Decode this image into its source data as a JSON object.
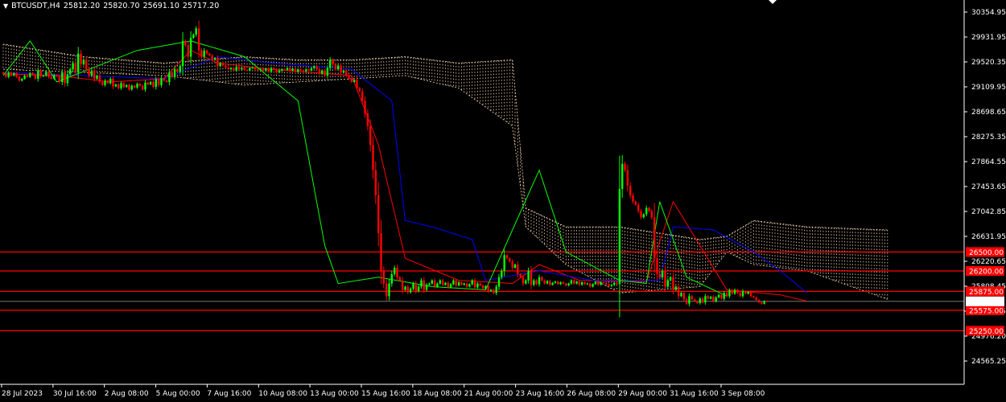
{
  "header": {
    "symbol": "BTCUSDT,H4",
    "open": "25812.20",
    "high": "25820.70",
    "low": "25691.10",
    "close": "25717.20"
  },
  "colors": {
    "background": "#000000",
    "bull": "#00ff00",
    "bear": "#ff0000",
    "tenkan": "#ff0000",
    "kijun": "#0000ff",
    "chikou": "#00ff00",
    "cloud": "#ffd8b0",
    "level": "#ff0000",
    "level_label_bg": "#ff0000",
    "price_label_bg": "#ffffff",
    "price_label_fg": "#000000"
  },
  "chart_data": {
    "type": "candlestick",
    "symbol": "BTCUSDT",
    "timeframe": "H4",
    "ylim": [
      24400,
      30500
    ],
    "y_ticks": [
      "30354.95",
      "29931.95",
      "29520.35",
      "29109.95",
      "28698.65",
      "28275.35",
      "27864.55",
      "27453.65",
      "27042.85",
      "26631.95",
      "26220.65",
      "25808.45",
      "25386.95",
      "24976.20",
      "24565.25"
    ],
    "x_ticks": [
      "28 Jul 2023",
      "30 Jul 16:00",
      "2 Aug 08:00",
      "5 Aug 00:00",
      "7 Aug 16:00",
      "10 Aug 08:00",
      "13 Aug 00:00",
      "15 Aug 16:00",
      "18 Aug 08:00",
      "21 Aug 00:00",
      "23 Aug 16:00",
      "26 Aug 08:00",
      "29 Aug 00:00",
      "31 Aug 16:00",
      "3 Sep 08:00"
    ],
    "horizontal_levels": [
      {
        "label": "26500.00",
        "value": 26500
      },
      {
        "label": "26200.00",
        "value": 26200
      },
      {
        "label": "25875.00",
        "value": 25875
      },
      {
        "label": "25575.00",
        "value": 25575
      },
      {
        "label": "25250.00",
        "value": 25250
      }
    ],
    "current_price": {
      "label": "25717.20",
      "value": 25717.2
    },
    "candles": {
      "close": [
        29330,
        29280,
        29350,
        29300,
        29340,
        29280,
        29220,
        29250,
        29300,
        29280,
        29340,
        29310,
        29250,
        29380,
        29290,
        29300,
        29360,
        29280,
        29250,
        29310,
        29290,
        29200,
        29350,
        29180,
        29320,
        29400,
        29500,
        29350,
        29650,
        29480,
        29550,
        29400,
        29300,
        29380,
        29250,
        29300,
        29200,
        29150,
        29220,
        29180,
        29250,
        29130,
        29160,
        29100,
        29180,
        29120,
        29150,
        29080,
        29140,
        29110,
        29170,
        29140,
        29080,
        29190,
        29160,
        29200,
        29120,
        29240,
        29150,
        29260,
        29220,
        29200,
        29350,
        29280,
        29400,
        29360,
        29450,
        29850,
        29780,
        29600,
        29900,
        29950,
        30050,
        29700,
        29600,
        29700,
        29650,
        29620,
        29550,
        29580,
        29450,
        29500,
        29460,
        29430,
        29400,
        29420,
        29380,
        29440,
        29400,
        29420,
        29390,
        29380,
        29420,
        29430,
        29400,
        29390,
        29400,
        29380,
        29410,
        29360,
        29420,
        29400,
        29350,
        29380,
        29400,
        29390,
        29420,
        29380,
        29410,
        29360,
        29400,
        29380,
        29370,
        29400,
        29380,
        29420,
        29450,
        29400,
        29330,
        29380,
        29300,
        29420,
        29550,
        29480,
        29400,
        29460,
        29350,
        29380,
        29300,
        29250,
        29200,
        29230,
        29100,
        29050,
        28900,
        28700,
        28500,
        28200,
        27800,
        27400,
        26800,
        26200,
        26000,
        25800,
        26000,
        26150,
        26250,
        26100,
        26050,
        25900,
        25950,
        25860,
        25920,
        26000,
        25880,
        25950,
        26050,
        25900,
        25980,
        26000,
        26050,
        25950,
        26000,
        26050,
        25980,
        26010,
        25940,
        25990,
        26050,
        25970,
        26020,
        25980,
        26000,
        25950,
        25990,
        26050,
        25940,
        26000,
        25970,
        25920,
        25960,
        25880,
        25900,
        25850,
        25950,
        26100,
        26200,
        26450,
        26400,
        26350,
        26250,
        26300,
        26150,
        26100,
        26000,
        26050,
        26200,
        25980,
        26050,
        25990,
        26100,
        26050,
        26000,
        26040,
        25980,
        26010,
        26030,
        25990,
        26020,
        26000,
        25970,
        26000,
        26050,
        26000,
        26030,
        25980,
        26020,
        25990,
        26000,
        25950,
        25990,
        26030,
        25980,
        26020,
        26010,
        25990,
        25960,
        25980,
        26010,
        25990,
        27500,
        27900,
        27800,
        27550,
        27400,
        27300,
        27250,
        27150,
        27050,
        27100,
        27200,
        27150,
        27050,
        26400,
        26150,
        26100,
        26200,
        25950,
        26050,
        26100,
        25900,
        25950,
        25800,
        25850,
        25750,
        25680,
        25800,
        25750,
        25720,
        25690,
        25760,
        25700,
        25800,
        25760,
        25790,
        25720,
        25780,
        25820,
        25760,
        25850,
        25800,
        25890,
        25840,
        25900,
        25850,
        25800,
        25880,
        25840,
        25870,
        25800,
        25780,
        25740,
        25700,
        25680,
        25720,
        25717.2
      ],
      "open_rule": "previous close",
      "wick_pct_of_body_range": 0.35
    },
    "series": [
      {
        "name": "Tenkan-sen",
        "points": [
          [
            0,
            29330
          ],
          [
            20,
            29300
          ],
          [
            40,
            29200
          ],
          [
            60,
            29250
          ],
          [
            70,
            29700
          ],
          [
            80,
            29500
          ],
          [
            100,
            29400
          ],
          [
            130,
            29300
          ],
          [
            140,
            28200
          ],
          [
            150,
            26400
          ],
          [
            170,
            26050
          ],
          [
            190,
            26000
          ],
          [
            200,
            26300
          ],
          [
            215,
            26050
          ],
          [
            240,
            26030
          ],
          [
            250,
            27300
          ],
          [
            260,
            26600
          ],
          [
            270,
            25900
          ],
          [
            290,
            25820
          ],
          [
            300,
            25720
          ]
        ]
      },
      {
        "name": "Kijun-sen",
        "points": [
          [
            0,
            29350
          ],
          [
            30,
            29300
          ],
          [
            60,
            29250
          ],
          [
            80,
            29600
          ],
          [
            100,
            29500
          ],
          [
            130,
            29400
          ],
          [
            145,
            28900
          ],
          [
            150,
            27000
          ],
          [
            160,
            26900
          ],
          [
            175,
            26700
          ],
          [
            180,
            26050
          ],
          [
            200,
            26200
          ],
          [
            220,
            26050
          ],
          [
            245,
            26050
          ],
          [
            250,
            26900
          ],
          [
            265,
            26850
          ],
          [
            280,
            26500
          ],
          [
            290,
            26200
          ],
          [
            300,
            25850
          ]
        ]
      },
      {
        "name": "Chikou Span",
        "points": [
          [
            0,
            29300
          ],
          [
            10,
            29850
          ],
          [
            20,
            29200
          ],
          [
            50,
            29700
          ],
          [
            70,
            29850
          ],
          [
            90,
            29600
          ],
          [
            110,
            28900
          ],
          [
            120,
            26600
          ],
          [
            125,
            26000
          ],
          [
            140,
            26100
          ],
          [
            160,
            25950
          ],
          [
            180,
            25900
          ],
          [
            200,
            27800
          ],
          [
            210,
            26500
          ],
          [
            230,
            26050
          ],
          [
            240,
            26000
          ],
          [
            245,
            27300
          ],
          [
            255,
            26100
          ],
          [
            270,
            25800
          ]
        ]
      }
    ],
    "cloud": {
      "name": "Ichimoku Kumo",
      "upper": [
        [
          0,
          29800
        ],
        [
          30,
          29600
        ],
        [
          60,
          29500
        ],
        [
          90,
          29600
        ],
        [
          110,
          29550
        ],
        [
          130,
          29550
        ],
        [
          150,
          29600
        ],
        [
          170,
          29500
        ],
        [
          190,
          29550
        ],
        [
          195,
          27200
        ],
        [
          210,
          26900
        ],
        [
          230,
          26900
        ],
        [
          260,
          26700
        ],
        [
          270,
          26750
        ],
        [
          280,
          27000
        ],
        [
          300,
          26900
        ],
        [
          330,
          26850
        ]
      ],
      "lower": [
        [
          0,
          29400
        ],
        [
          30,
          29350
        ],
        [
          60,
          29300
        ],
        [
          90,
          29150
        ],
        [
          110,
          29200
        ],
        [
          130,
          29250
        ],
        [
          150,
          29300
        ],
        [
          170,
          29100
        ],
        [
          190,
          28500
        ],
        [
          195,
          26900
        ],
        [
          210,
          26300
        ],
        [
          230,
          25850
        ],
        [
          260,
          25950
        ],
        [
          270,
          26500
        ],
        [
          280,
          26300
        ],
        [
          300,
          26200
        ],
        [
          330,
          25750
        ]
      ]
    }
  }
}
